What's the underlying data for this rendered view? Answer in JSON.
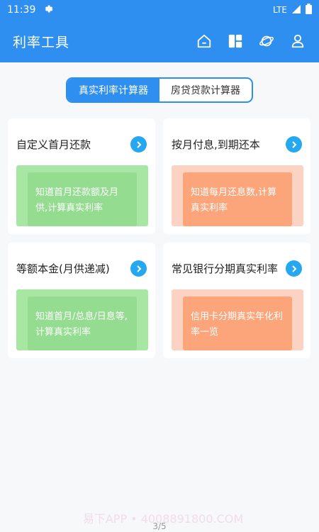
{
  "status": {
    "time": "11:39",
    "network": "LTE"
  },
  "appbar": {
    "title": "利率工具"
  },
  "tabs": [
    {
      "label": "真实利率计算器",
      "active": true
    },
    {
      "label": "房贷贷款计算器",
      "active": false
    }
  ],
  "cards": [
    {
      "title": "自定义首月还款",
      "desc": "知道首月还款额及月供,计算真实利率",
      "theme": "green"
    },
    {
      "title": "按月付息,到期还本",
      "desc": "知道每月还息数,计算真实利率",
      "theme": "orange"
    },
    {
      "title": "等额本金(月供递减)",
      "desc": "知道首月/总息/日息等,计算真实利率",
      "theme": "green"
    },
    {
      "title": "常见银行分期真实利率",
      "desc": "信用卡分期真实年化利率一览",
      "theme": "orange"
    }
  ],
  "footer": {
    "watermark": "易下APP • 4008891800.COM",
    "page": "3/5"
  },
  "colors": {
    "primary": "#2e8ff0",
    "arrow": "#25a8ef",
    "green": "#94dc90",
    "orange": "#fca57a"
  }
}
